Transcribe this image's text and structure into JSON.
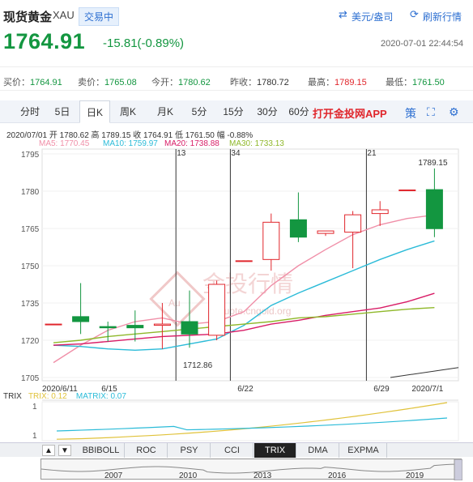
{
  "header": {
    "title": "现货黄金",
    "code": "XAU",
    "status": "交易中",
    "currency_link": "美元/盎司",
    "refresh_link": "刷新行情"
  },
  "price": {
    "last": "1764.91",
    "change": "-15.81(-0.89%)",
    "time": "2020-07-01 22:44:54"
  },
  "quotes": [
    {
      "label": "买价：",
      "value": "1764.91",
      "color": "#139640"
    },
    {
      "label": "卖价：",
      "value": "1765.08",
      "color": "#139640"
    },
    {
      "label": "今开：",
      "value": "1780.62",
      "color": "#139640"
    },
    {
      "label": "昨收：",
      "value": "1780.72",
      "color": "#333333"
    },
    {
      "label": "最高：",
      "value": "1789.15",
      "color": "#e0262c"
    },
    {
      "label": "最低：",
      "value": "1761.50",
      "color": "#139640"
    }
  ],
  "tabs": {
    "items": [
      "分时",
      "5日",
      "日K",
      "周K",
      "月K",
      "5分",
      "15分",
      "30分",
      "60分"
    ],
    "active": "日K",
    "promo": "打开金投网APP"
  },
  "ohlc_line": "2020/07/01  开 1780.62  高 1789.15  收 1764.91  低 1761.50  幅 -0.88%",
  "ma_legend": [
    {
      "text": "MA5: 1770.45",
      "color": "#f08fa8"
    },
    {
      "text": "MA10: 1759.97",
      "color": "#2bbbd8"
    },
    {
      "text": "MA20: 1738.88",
      "color": "#d81c66"
    },
    {
      "text": "MA30: 1733.13",
      "color": "#8fb82a"
    }
  ],
  "chart_data": {
    "type": "candlestick",
    "y_ticks": [
      "1795",
      "1780",
      "1765",
      "1750",
      "1735",
      "1720",
      "1705"
    ],
    "x_labels": [
      "2020/6/11",
      "6/15",
      "6/22",
      "6/29",
      "2020/7/1"
    ],
    "annotations": {
      "max_label": "1789.15",
      "min_label": "1712.86",
      "marker_13": "13",
      "marker_34": "34",
      "marker_21": "21"
    },
    "up_color": "#e0262c",
    "down_color": "#139640",
    "candles": [
      {
        "date": "6/11",
        "open": 1726.5,
        "close": 1726.5,
        "high": 1726.5,
        "low": 1726.5
      },
      {
        "date": "6/12",
        "open": 1729.5,
        "close": 1727.5,
        "high": 1743.0,
        "low": 1722.5
      },
      {
        "date": "6/15",
        "open": 1725.5,
        "close": 1725.0,
        "high": 1727.5,
        "low": 1719.5
      },
      {
        "date": "6/16",
        "open": 1726.0,
        "close": 1725.0,
        "high": 1732.0,
        "low": 1719.5
      },
      {
        "date": "6/17",
        "open": 1726.0,
        "close": 1726.5,
        "high": 1735.0,
        "low": 1716.5
      },
      {
        "date": "6/18",
        "open": 1727.5,
        "close": 1722.5,
        "high": 1740.0,
        "low": 1717.0
      },
      {
        "date": "6/19",
        "open": 1722.0,
        "close": 1742.5,
        "high": 1744.0,
        "low": 1720.0
      },
      {
        "date": "6/22",
        "open": 1752.0,
        "close": 1752.0,
        "high": 1752.0,
        "low": 1752.0
      },
      {
        "date": "6/23",
        "open": 1752.5,
        "close": 1767.5,
        "high": 1771.0,
        "low": 1748.0
      },
      {
        "date": "6/24",
        "open": 1768.5,
        "close": 1761.5,
        "high": 1779.5,
        "low": 1759.5
      },
      {
        "date": "6/25",
        "open": 1763.0,
        "close": 1764.0,
        "high": 1764.0,
        "low": 1762.0
      },
      {
        "date": "6/26",
        "open": 1763.5,
        "close": 1770.5,
        "high": 1772.0,
        "low": 1749.0
      },
      {
        "date": "6/29",
        "open": 1771.0,
        "close": 1772.5,
        "high": 1776.0,
        "low": 1766.0
      },
      {
        "date": "6/30",
        "open": 1780.5,
        "close": 1780.5,
        "high": 1780.5,
        "low": 1780.5
      },
      {
        "date": "7/1",
        "open": 1780.62,
        "close": 1764.91,
        "high": 1789.15,
        "low": 1761.5
      }
    ],
    "ma_series": [
      {
        "name": "MA5",
        "color": "#f08fa8",
        "values": [
          1711.0,
          1718.0,
          1724.0,
          1727.5,
          1729.0,
          1726.5,
          1727.5,
          1731.5,
          1742.0,
          1750.0,
          1756.5,
          1762.5,
          1766.5,
          1769.0,
          1770.45
        ]
      },
      {
        "name": "MA10",
        "color": "#2bbbd8",
        "values": [
          1718.0,
          1717.5,
          1716.5,
          1716.0,
          1716.5,
          1718.5,
          1720.5,
          1726.0,
          1734.0,
          1739.0,
          1743.5,
          1748.0,
          1752.5,
          1756.5,
          1759.97
        ]
      },
      {
        "name": "MA20",
        "color": "#d81c66",
        "values": [
          1718.0,
          1718.5,
          1719.5,
          1720.5,
          1721.5,
          1722.0,
          1722.5,
          1724.0,
          1726.5,
          1728.0,
          1730.0,
          1731.5,
          1733.0,
          1735.5,
          1738.88
        ]
      },
      {
        "name": "MA30",
        "color": "#8fb82a",
        "values": [
          1719.0,
          1720.0,
          1721.5,
          1722.5,
          1723.5,
          1724.5,
          1725.5,
          1726.5,
          1727.5,
          1729.0,
          1729.5,
          1730.5,
          1731.5,
          1732.5,
          1733.13
        ]
      }
    ],
    "ylim": [
      1705,
      1795
    ]
  },
  "trix": {
    "title": "TRIX",
    "trix_label": "TRIX: 0.12",
    "matrix_label": "MATRIX: 0.07",
    "trix_color": "#e0c23a",
    "matrix_color": "#2bbbd8",
    "y_ticks": [
      "1",
      "1"
    ]
  },
  "indicators": {
    "items": [
      "BBIBOLL",
      "ROC",
      "PSY",
      "CCI",
      "TRIX",
      "DMA",
      "EXPMA"
    ],
    "active": "TRIX"
  },
  "navigator": {
    "years": [
      "2007",
      "2010",
      "2013",
      "2016",
      "2019"
    ]
  },
  "watermark": {
    "text": "金投行情",
    "url": "quote.cngold.org",
    "badge": "Au"
  }
}
